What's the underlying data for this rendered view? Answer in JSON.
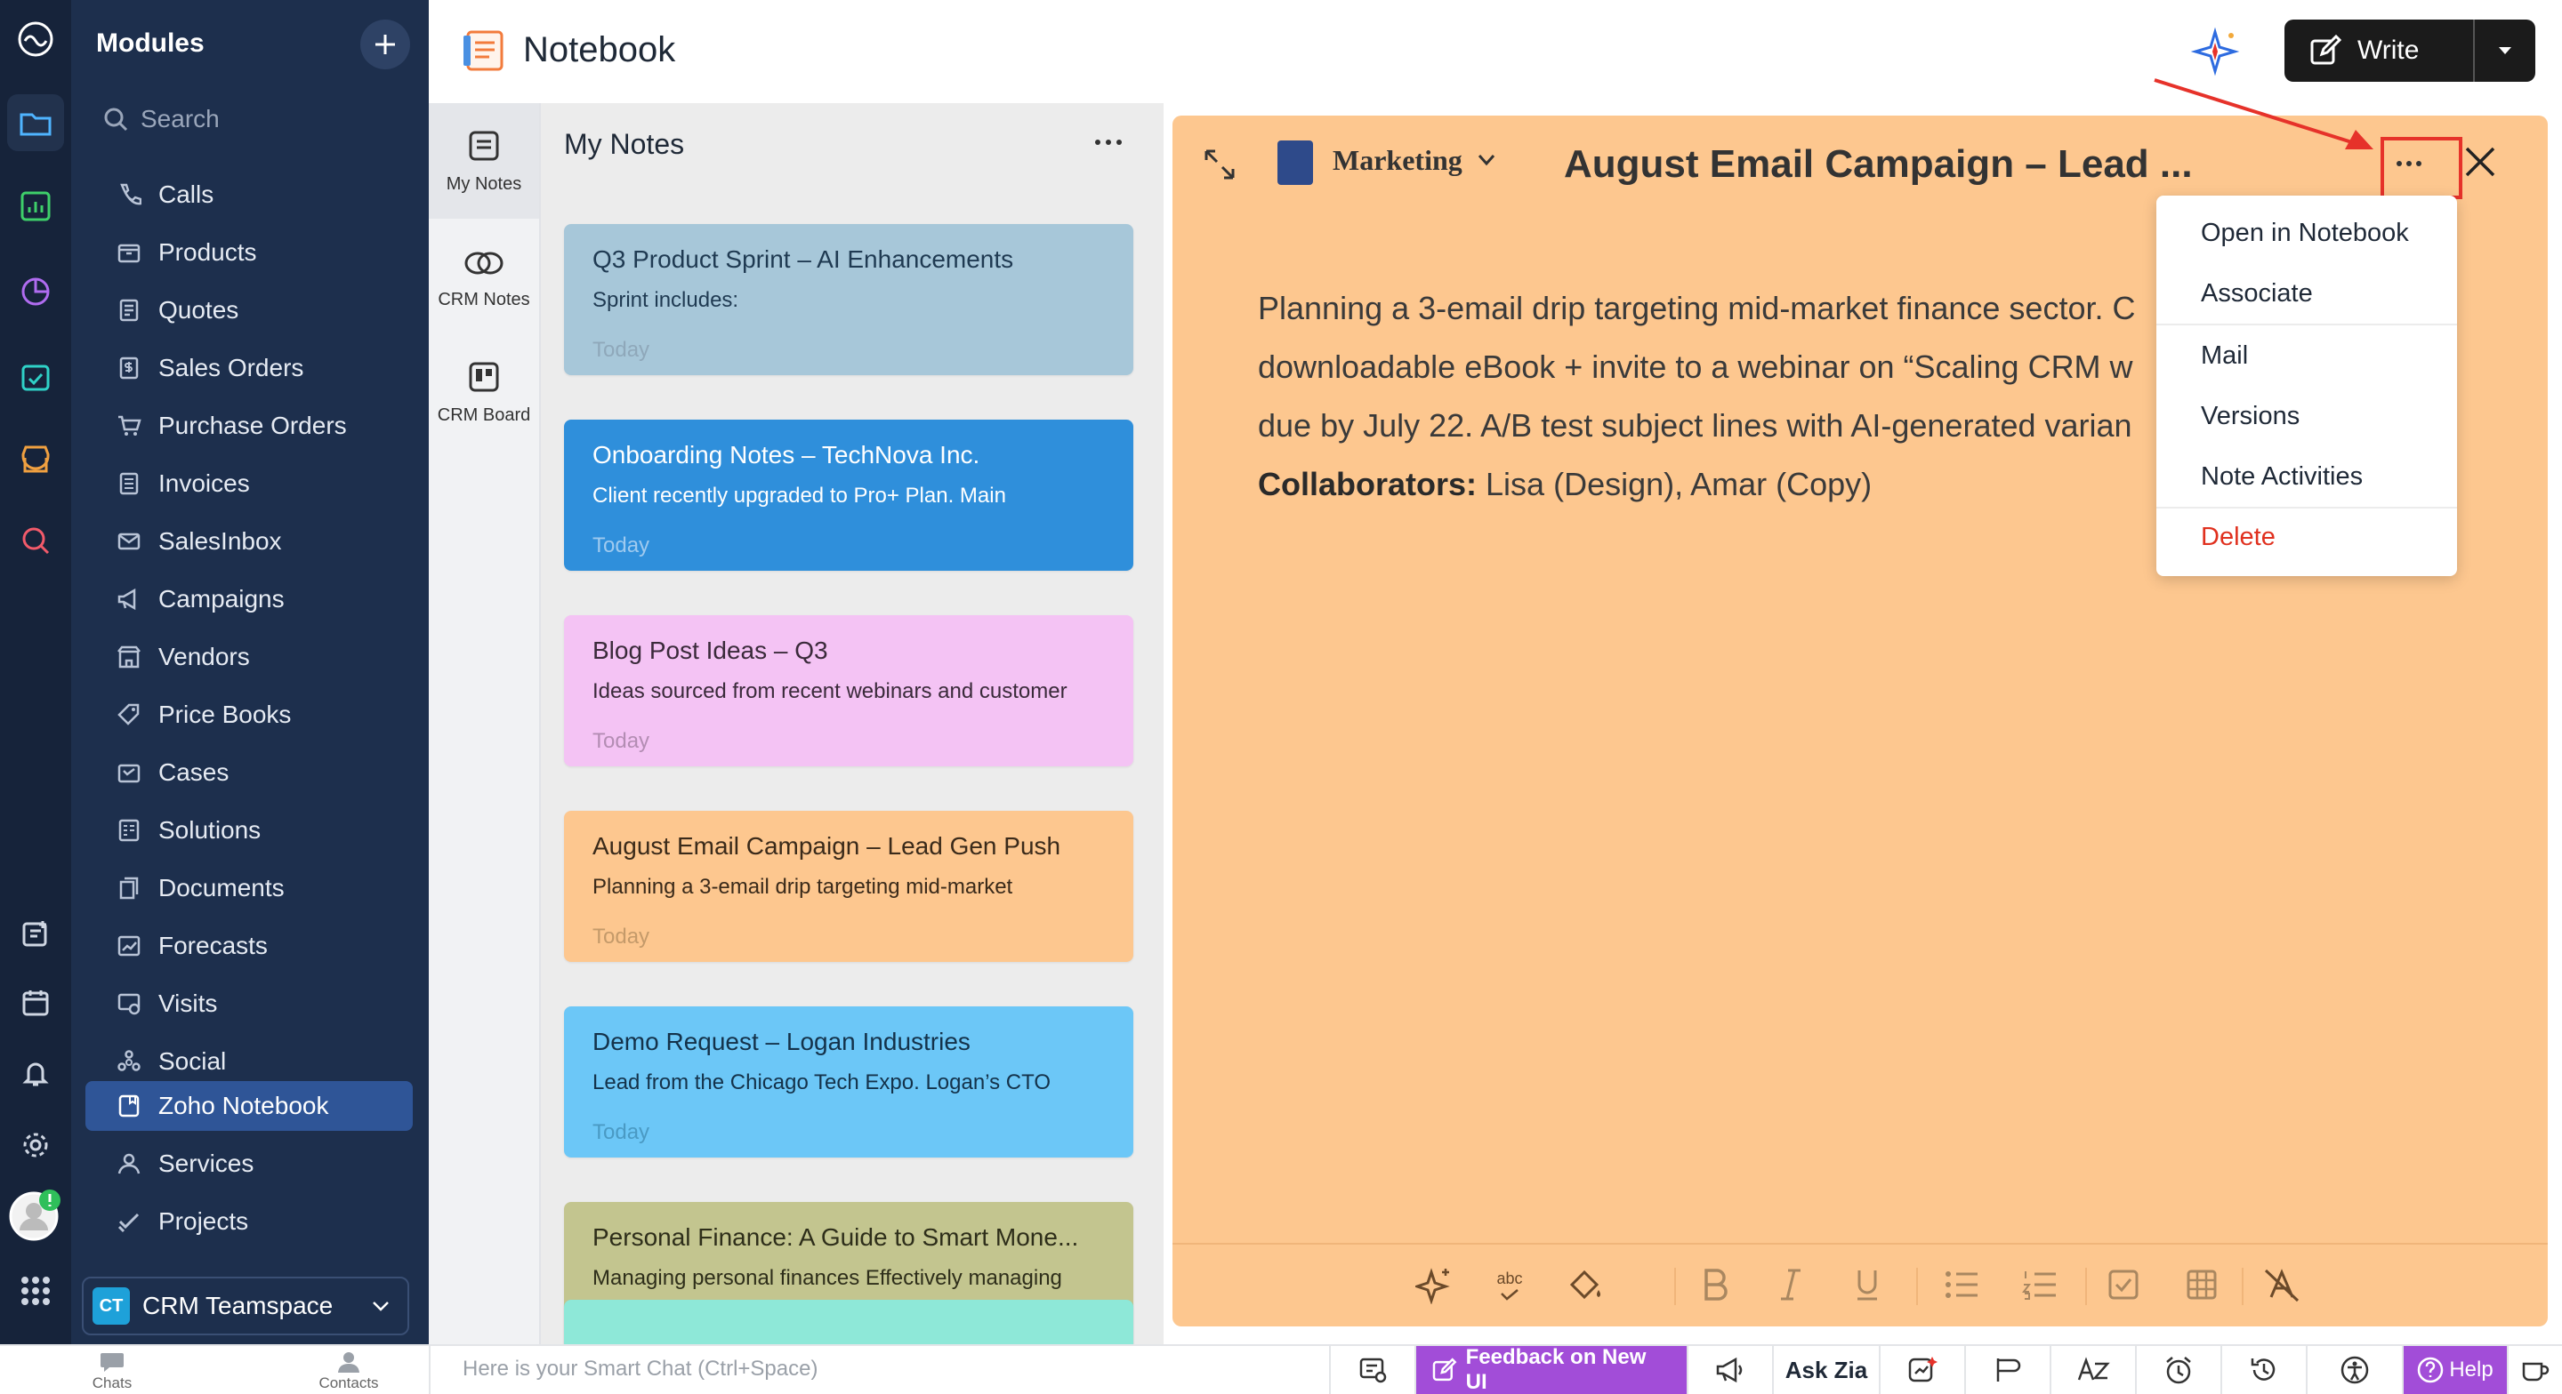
{
  "sidebar": {
    "title": "Modules",
    "search_placeholder": "Search",
    "items": [
      {
        "label": "Calls"
      },
      {
        "label": "Products"
      },
      {
        "label": "Quotes"
      },
      {
        "label": "Sales Orders"
      },
      {
        "label": "Purchase Orders"
      },
      {
        "label": "Invoices"
      },
      {
        "label": "SalesInbox"
      },
      {
        "label": "Campaigns"
      },
      {
        "label": "Vendors"
      },
      {
        "label": "Price Books"
      },
      {
        "label": "Cases"
      },
      {
        "label": "Solutions"
      },
      {
        "label": "Documents"
      },
      {
        "label": "Forecasts"
      },
      {
        "label": "Visits"
      },
      {
        "label": "Social"
      },
      {
        "label": "Zoho Notebook",
        "active": true
      },
      {
        "label": "Services"
      },
      {
        "label": "Projects"
      }
    ],
    "teamspace": {
      "badge": "CT",
      "name": "CRM Teamspace"
    }
  },
  "header": {
    "title": "Notebook",
    "write_label": "Write"
  },
  "notebook_nav": [
    {
      "label": "My Notes",
      "active": true
    },
    {
      "label": "CRM Notes"
    },
    {
      "label": "CRM Board"
    }
  ],
  "notes_list": {
    "title": "My Notes",
    "cards": [
      {
        "title": "Q3 Product Sprint – AI Enhancements",
        "snippet": "Sprint includes:",
        "date": "Today",
        "bg": "#a7c7d9",
        "fg": "#1f3a52",
        "date_color": "#8fa8ba"
      },
      {
        "title": "Onboarding Notes – TechNova Inc.",
        "snippet": "Client recently upgraded to Pro+ Plan. Main",
        "date": "Today",
        "bg": "#2f8fdb",
        "fg": "#ffffff",
        "date_color": "#9fcaef"
      },
      {
        "title": "Blog Post Ideas – Q3",
        "snippet": "Ideas sourced from recent webinars and customer",
        "date": "Today",
        "bg": "#f4c3f4",
        "fg": "#3a2a3a",
        "date_color": "#b38db3"
      },
      {
        "title": "August Email Campaign – Lead Gen Push",
        "snippet": "Planning a 3-email drip targeting mid-market",
        "date": "Today",
        "bg": "#fdc78f",
        "fg": "#3a2a1a",
        "date_color": "#c49a6a"
      },
      {
        "title": "Demo Request – Logan Industries",
        "snippet": "Lead from the Chicago Tech Expo. Logan’s CTO",
        "date": "Today",
        "bg": "#6cc7f7",
        "fg": "#14324a",
        "date_color": "#4a9ac4"
      },
      {
        "title": "Personal Finance: A Guide to Smart Mone...",
        "snippet": "Managing personal finances Effectively managing",
        "date": "Today",
        "bg": "#c3c58f",
        "fg": "#2e2e1a",
        "date_color": "#8f9166"
      }
    ],
    "peek_bg": "#8ee8d8"
  },
  "note": {
    "notebook_name": "Marketing",
    "title": "August Email Campaign – Lead ...",
    "line1": "Planning a 3-email drip targeting mid-market finance sector. C",
    "line2": "downloadable eBook + invite to a webinar on “Scaling CRM w",
    "line3": "due by July 22. A/B test subject lines with AI-generated varian",
    "collab_label": "Collaborators:",
    "collab_value": " Lisa (Design), Amar (Copy)",
    "toolbar": {
      "spell_label": "abc"
    }
  },
  "menu": {
    "items": [
      "Open in Notebook",
      "Associate",
      "Mail",
      "Versions",
      "Note Activities",
      "Delete"
    ]
  },
  "bottom": {
    "chats_label": "Chats",
    "contacts_label": "Contacts",
    "chat_placeholder": "Here is your Smart Chat (Ctrl+Space)",
    "feedback_label": "Feedback on New UI",
    "askzia_label": "Ask Zia",
    "help_label": "Help"
  },
  "colors": {
    "rail_bg": "#16233a",
    "sidebar_bg": "#1d2f4d",
    "active_nav": "#2f5597",
    "note_bg": "#fdc78f",
    "annotation_red": "#e6322a",
    "feedback_purple": "#a24dd8"
  }
}
